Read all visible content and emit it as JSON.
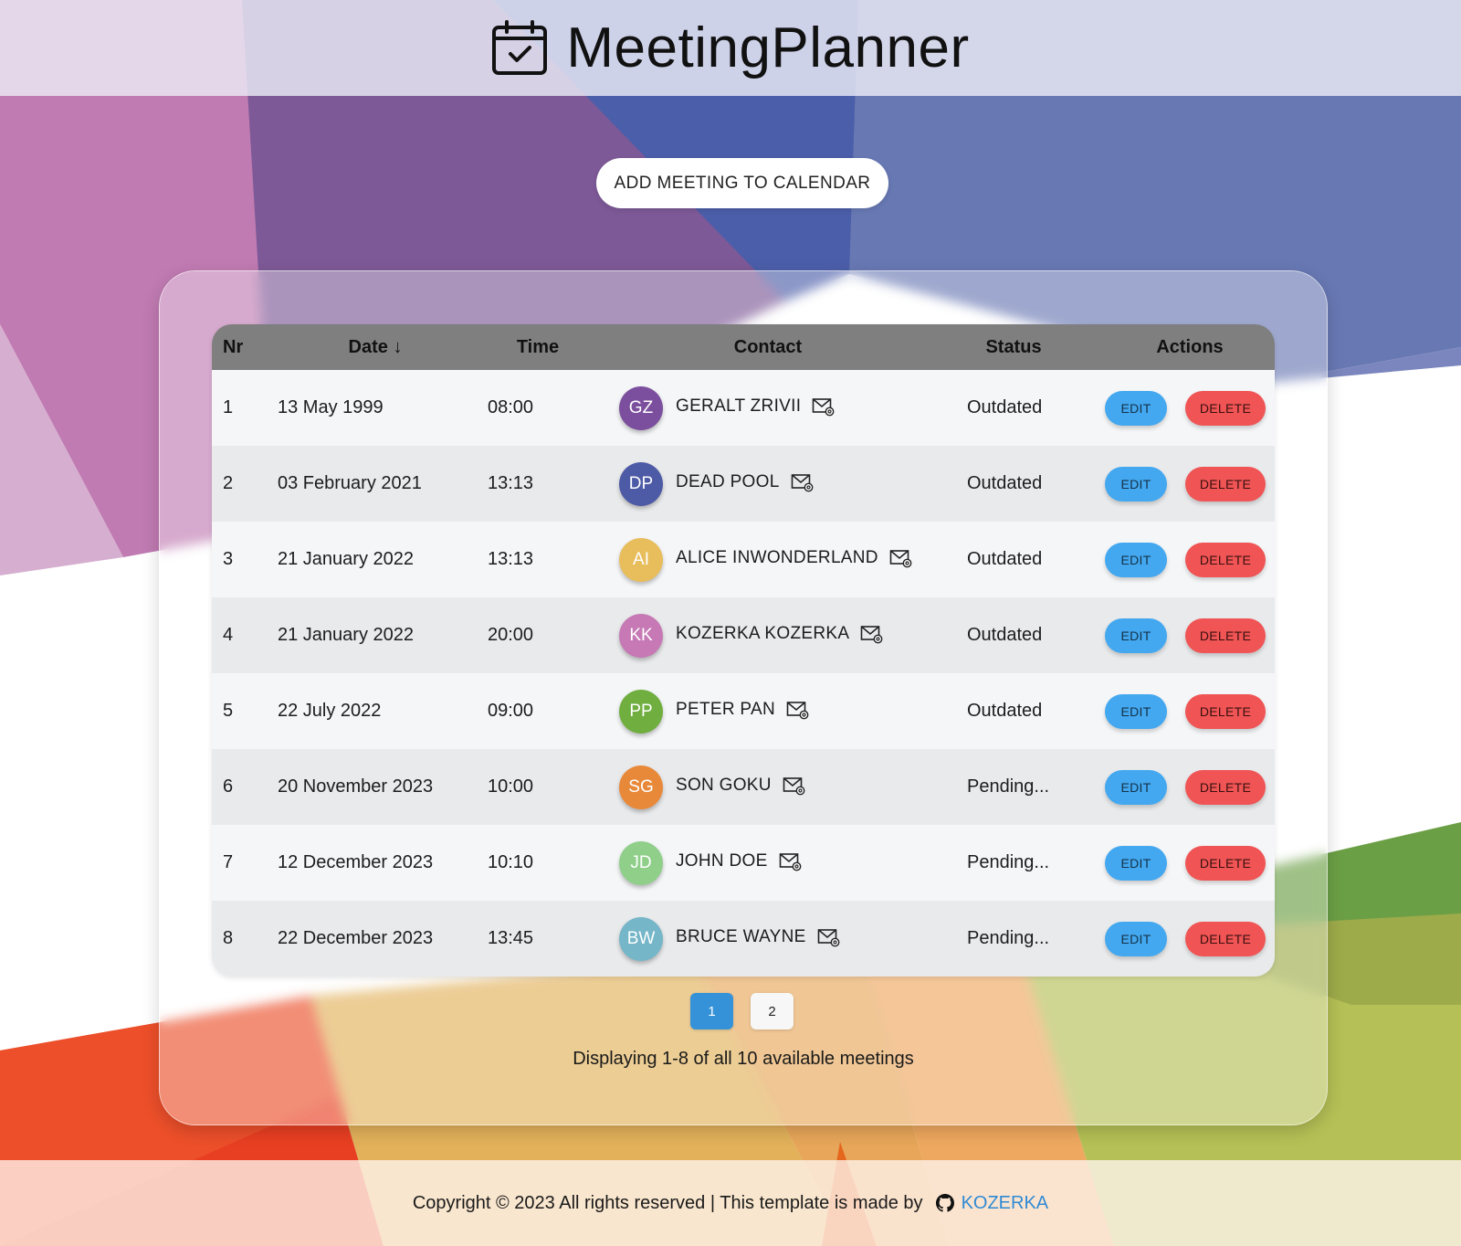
{
  "header": {
    "title": "MeetingPlanner",
    "logo_icon": "calendar-check-icon"
  },
  "add_button": {
    "label": "ADD MEETING TO CALENDAR"
  },
  "table": {
    "columns": {
      "nr": "Nr",
      "date": "Date ↓",
      "time": "Time",
      "contact": "Contact",
      "status": "Status",
      "actions": "Actions"
    },
    "rows": [
      {
        "nr": "1",
        "date": "13 May 1999",
        "time": "08:00",
        "initials": "GZ",
        "name": "GERALT ZRIVII",
        "avatar_color": "#7b4f9d",
        "status": "Outdated"
      },
      {
        "nr": "2",
        "date": "03 February 2021",
        "time": "13:13",
        "initials": "DP",
        "name": "DEAD POOL",
        "avatar_color": "#4d5aa6",
        "status": "Outdated"
      },
      {
        "nr": "3",
        "date": "21 January 2022",
        "time": "13:13",
        "initials": "AI",
        "name": "ALICE INWONDERLAND",
        "avatar_color": "#e8bd5c",
        "status": "Outdated"
      },
      {
        "nr": "4",
        "date": "21 January 2022",
        "time": "20:00",
        "initials": "KK",
        "name": "KOZERKA KOZERKA",
        "avatar_color": "#c679b4",
        "status": "Outdated"
      },
      {
        "nr": "5",
        "date": "22 July 2022",
        "time": "09:00",
        "initials": "PP",
        "name": "PETER PAN",
        "avatar_color": "#6fae3f",
        "status": "Outdated"
      },
      {
        "nr": "6",
        "date": "20 November 2023",
        "time": "10:00",
        "initials": "SG",
        "name": "SON GOKU",
        "avatar_color": "#e8893a",
        "status": "Pending..."
      },
      {
        "nr": "7",
        "date": "12 December 2023",
        "time": "10:10",
        "initials": "JD",
        "name": "JOHN DOE",
        "avatar_color": "#8fcf8a",
        "status": "Pending..."
      },
      {
        "nr": "8",
        "date": "22 December 2023",
        "time": "13:45",
        "initials": "BW",
        "name": "BRUCE WAYNE",
        "avatar_color": "#75b6c8",
        "status": "Pending..."
      }
    ],
    "edit_label": "EDIT",
    "delete_label": "DELETE",
    "mail_icon": "mail-at-icon"
  },
  "pagination": {
    "pages": [
      "1",
      "2"
    ],
    "active": "1"
  },
  "display_info": "Displaying 1-8 of all 10 available meetings",
  "footer": {
    "text": "Copyright © 2023 All rights reserved | This template is made by",
    "link": "KOZERKA",
    "link_icon": "github-icon"
  },
  "colors": {
    "edit": "#43a8ef",
    "delete": "#f05454",
    "active_page": "#3592d8",
    "link": "#2f8ad4"
  }
}
